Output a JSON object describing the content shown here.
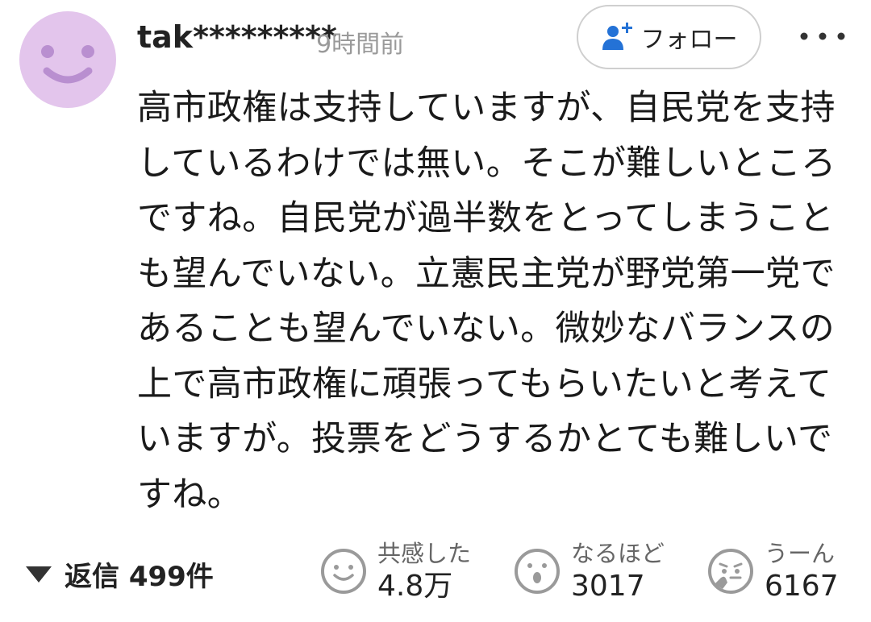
{
  "comment": {
    "username": "tak*********",
    "time_ago": "9時間前",
    "follow_label": "フォロー",
    "text": "高市政権は支持していますが、自民党を支持しているわけでは無い。そこが難しいところですね。自民党が過半数をとってしまうことも望んでいない。立憲民主党が野党第一党であることも望んでいない。微妙なバランスの上で高市政権に頑張ってもらいたいと考えていますが。投票をどうするかとても難しいですね。"
  },
  "footer": {
    "replies_label": "返信 499件",
    "reactions": [
      {
        "icon": "smile-face-icon",
        "label": "共感した",
        "count": "4.8万"
      },
      {
        "icon": "surprised-face-icon",
        "label": "なるほど",
        "count": "3017"
      },
      {
        "icon": "thinking-face-icon",
        "label": "うーん",
        "count": "6167"
      }
    ]
  },
  "colors": {
    "avatar_bg": "#e3c5ec",
    "avatar_face": "#b98fd0",
    "follow_icon": "#2472d6",
    "muted_text": "#9a9a9a",
    "icon_gray": "#9a9a9a"
  }
}
